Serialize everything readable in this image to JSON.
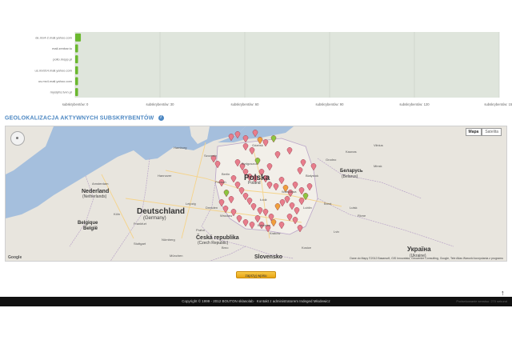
{
  "chart": {
    "background": "#dfe5dc",
    "bar_color": "#6bb82f"
  },
  "chart_data": {
    "type": "bar",
    "orientation": "horizontal",
    "categories": [
      "de.mx4-2.mail.yahoo.com",
      "mail.zenbar.tu",
      "pollo.mopp.pl",
      "us.mx914.mail.yahoo.com",
      "us.mx4.mail.yahoo.com",
      "mysiphs.tvxn.pl"
    ],
    "values": [
      2,
      1,
      1,
      1,
      1,
      1
    ],
    "xticks": [
      "subskrybentów: 0",
      "subskrybentów: 30",
      "subskrybentów: 60",
      "subskrybentów: 90",
      "subskrybentów: 120",
      "subskrybentów: 150"
    ],
    "xlim": [
      0,
      150
    ],
    "grid": true
  },
  "section": {
    "title": "GEOLOKALIZACJA AKTYWNYCH SUBSKRYBENTÓW",
    "info_icon": "info-icon",
    "info_glyph": "i"
  },
  "map": {
    "type_controls": [
      "Mapa",
      "Satelita"
    ],
    "countries": [
      {
        "name": "Polska",
        "size": "big"
      },
      {
        "name": "Deutschland",
        "size": "big"
      },
      {
        "name": "(Germany)",
        "size": "sub"
      },
      {
        "name": "Nederland",
        "size": "mid"
      },
      {
        "name": "(Netherlands)",
        "size": "sub"
      },
      {
        "name": "Belgique",
        "size": "mid"
      },
      {
        "name": "België",
        "size": "mid"
      },
      {
        "name": "Česká republika",
        "size": "mid"
      },
      {
        "name": "(Czech Republic)",
        "size": "sub"
      },
      {
        "name": "Slovensko",
        "size": "mid"
      },
      {
        "name": "Беларусь",
        "size": "mid"
      },
      {
        "name": "(Belarus)",
        "size": "sub"
      },
      {
        "name": "Україна",
        "size": "big"
      },
      {
        "name": "(Ukraine)",
        "size": "sub"
      },
      {
        "name": "Poland",
        "size": "sub"
      }
    ],
    "cities": [
      "Hamburg",
      "Berlin",
      "Hannover",
      "Amsterdam",
      "Köln",
      "Frankfurt",
      "München",
      "Praha",
      "Wrocław",
      "Kraków",
      "Warszawa",
      "Gdańsk",
      "Poznań",
      "Łódź",
      "Lublin",
      "Minsk",
      "Vilnius",
      "Białystok",
      "Brest",
      "Lviv",
      "Kosice",
      "Dresden",
      "Leipzig",
      "Nürnberg",
      "Stuttgart",
      "Brno",
      "Katowice",
      "Szczecin",
      "Bydgoszcz",
      "Grodno",
      "Kaunas",
      "Rivne",
      "Lutsk"
    ],
    "footer": "Dane do Mapy ©2012 Basarsoft, GIS Innovatsia, Geocentre Consulting, Google, Tele Atlas   Warunki korzystania z programu",
    "google": "Google",
    "marker_colors": [
      "#e87d8c",
      "#f0a03c",
      "#8cc63f"
    ]
  },
  "buttons": {
    "load": "zaprzyj wpisu"
  },
  "footer": {
    "copyright": "Copyright © 1999 - 2012 BOUTON sklasolab  ·  Kontakt z administratorem  Indeged Młodewicz",
    "generated": "Podsekowanie serwisu: 270 sekund"
  },
  "scroll_top": "↑"
}
